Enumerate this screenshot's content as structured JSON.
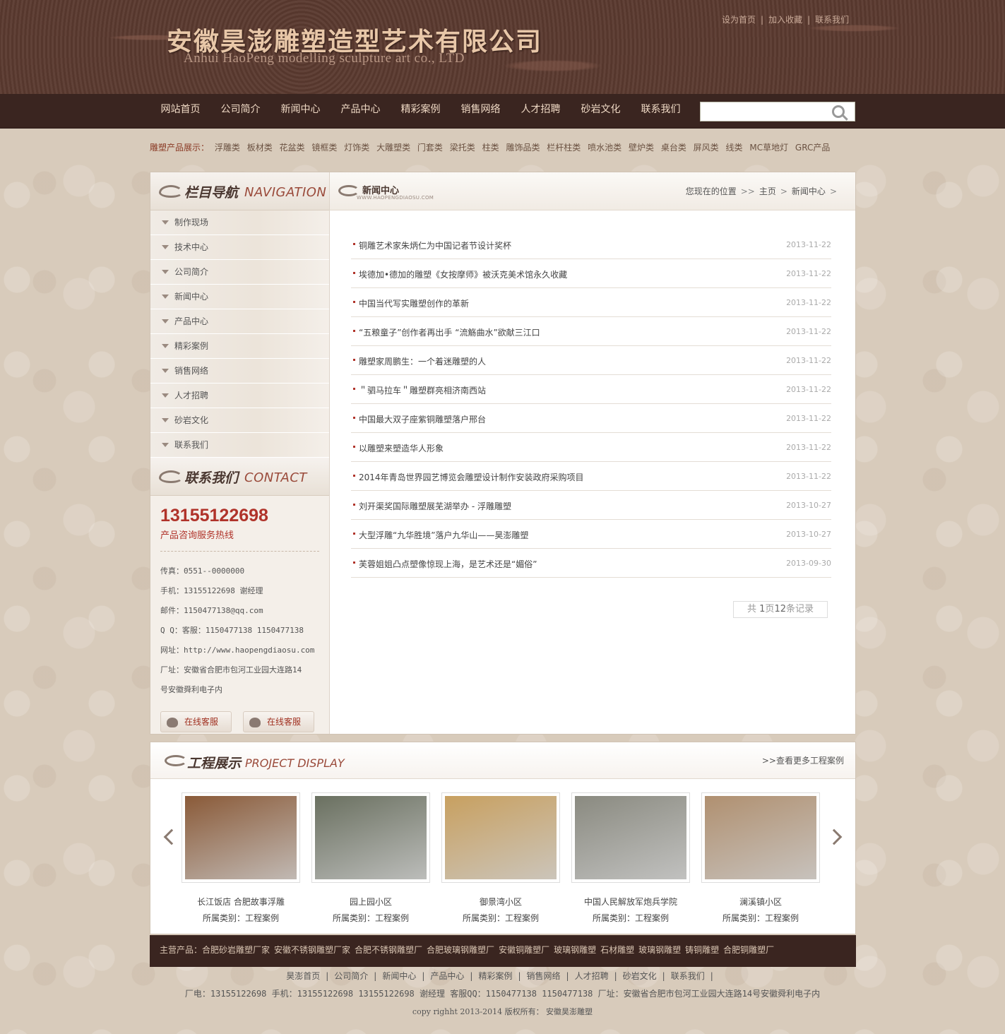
{
  "header": {
    "logo_cn": "安徽昊澎雕塑造型艺术有限公司",
    "logo_en": "Anhui HaoPeng modelling sculpture art co., LTD",
    "toplinks": [
      "设为首页",
      "加入收藏",
      "联系我们"
    ]
  },
  "nav": {
    "items": [
      "网站首页",
      "公司简介",
      "新闻中心",
      "产品中心",
      "精彩案例",
      "销售网络",
      "人才招聘",
      "砂岩文化",
      "联系我们"
    ],
    "search_placeholder": ""
  },
  "product_bar": {
    "lead": "雕塑产品展示：",
    "items": [
      "浮雕类",
      "板材类",
      "花盆类",
      "镜框类",
      "灯饰类",
      "大雕塑类",
      "门套类",
      "梁托类",
      "柱类",
      "雕饰品类",
      "栏杆柱类",
      "喷水池类",
      "壁炉类",
      "桌台类",
      "屏风类",
      "线类",
      "MC草地灯",
      "GRC产品"
    ]
  },
  "sidebar": {
    "nav_title_cn": "栏目导航",
    "nav_title_en": "NAVIGATION",
    "items": [
      "制作现场",
      "技术中心",
      "公司简介",
      "新闻中心",
      "产品中心",
      "精彩案例",
      "销售网络",
      "人才招聘",
      "砂岩文化",
      "联系我们"
    ],
    "contact_title_cn": "联系我们",
    "contact_title_en": "CONTACT",
    "hotline": "13155122698",
    "hotline_label": "产品咨询服务热线",
    "info": [
      "传真：0551--0000000",
      "手机：13155122698 谢经理",
      "邮件：1150477138@qq.com",
      "Q Q：客服：1150477138   1150477138",
      "网址：http://www.haopengdiaosu.com",
      "厂址：安徽省合肥市包河工业园大连路14",
      "号安徽舜利电子内"
    ],
    "qq_buttons": [
      "在线客服",
      "在线客服"
    ]
  },
  "content": {
    "title_cn": "新闻中心",
    "title_en": "WWW.HAOPENGDIAOSU.COM",
    "crumb_lead": "您现在的位置",
    "crumb": [
      "主页",
      "新闻中心"
    ],
    "news": [
      {
        "title": "铜雕艺术家朱炳仁为中国记者节设计奖杯",
        "date": "2013-11-22"
      },
      {
        "title": "埃德加•德加的雕塑《女按摩师》被沃克美术馆永久收藏",
        "date": "2013-11-22"
      },
      {
        "title": "中国当代写实雕塑创作的革新",
        "date": "2013-11-22"
      },
      {
        "title": "“五粮童子”创作者再出手 “流觞曲水”欲献三江口",
        "date": "2013-11-22"
      },
      {
        "title": "雕塑家周鹏生：一个着迷雕塑的人",
        "date": "2013-11-22"
      },
      {
        "title": "＂驷马拉车＂雕塑群亮相济南西站",
        "date": "2013-11-22"
      },
      {
        "title": "中国最大双子座紫铜雕塑落户邢台",
        "date": "2013-11-22"
      },
      {
        "title": "以雕塑来塑造华人形象",
        "date": "2013-11-22"
      },
      {
        "title": "2014年青岛世界园艺博览会雕塑设计制作安装政府采购项目",
        "date": "2013-11-22"
      },
      {
        "title": "刘开渠奖国际雕塑展芜湖举办 - 浮雕雕塑",
        "date": "2013-10-27"
      },
      {
        "title": "大型浮雕“九华胜境”落户九华山——昊澎雕塑",
        "date": "2013-10-27"
      },
      {
        "title": "芙蓉姐姐凸点塑像惊现上海，是艺术还是“媚俗”",
        "date": "2013-09-30"
      }
    ],
    "pager": {
      "pre": "共",
      "pages": "1",
      "mid": "页",
      "records": "12",
      "post": "条记录"
    }
  },
  "projects": {
    "title_cn": "工程展示",
    "title_en": "PROJECT DISPLAY",
    "more": ">>查看更多工程案例",
    "items": [
      {
        "name": "长江饭店 合肥故事浮雕",
        "cat": "所属类别：工程案例",
        "color": "#8a5a38"
      },
      {
        "name": "园上园小区",
        "cat": "所属类别：工程案例",
        "color": "#6a7060"
      },
      {
        "name": "御景湾小区",
        "cat": "所属类别：工程案例",
        "color": "#c8a060"
      },
      {
        "name": "中国人民解放军炮兵学院",
        "cat": "所属类别：工程案例",
        "color": "#8a8a80"
      },
      {
        "name": "澜溪镇小区",
        "cat": "所属类别：工程案例",
        "color": "#b09070"
      }
    ]
  },
  "footer": {
    "main_products": [
      "主营产品：合肥砂岩雕塑厂家",
      "安徽不锈钢雕塑厂家",
      "合肥不锈钢雕塑厂",
      "合肥玻璃钢雕塑厂",
      "安徽铜雕塑厂",
      "玻璃钢雕塑",
      "石材雕塑",
      "玻璃钢雕塑",
      "铸铜雕塑",
      "合肥铜雕塑厂"
    ],
    "links": [
      "昊澎首页",
      "公司简介",
      "新闻中心",
      "产品中心",
      "精彩案例",
      "销售网络",
      "人才招聘",
      "砂岩文化",
      "联系我们"
    ],
    "info": "厂电：13155122698 手机：13155122698 13155122698 谢经理 客服QQ：1150477138 1150477138 厂址：安徽省合肥市包河工业园大连路14号安徽舜利电子内",
    "copy": "copy righht 2013-2014 版权所有： 安徽昊澎雕塑"
  }
}
